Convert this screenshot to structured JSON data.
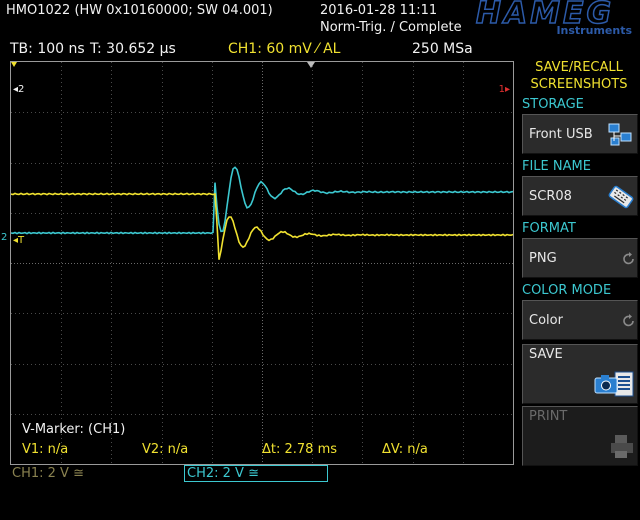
{
  "header": {
    "model": "HMO1022 (HW 0x10160000; SW 04.001)",
    "datetime": "2016-01-28 11:11",
    "status": "Norm-Trig. / Complete",
    "brand": "HAMEG",
    "brand_sub": "Instruments"
  },
  "acq": {
    "timebase": "TB: 100 ns",
    "trigger_time": "T: 30.652 µs",
    "ch1_trigger": "CH1: 60 mV ⁄ AL",
    "sample_rate": "250 MSa"
  },
  "markers": {
    "ch2_level": "2",
    "ch1_level": "1",
    "trigger_left": "T",
    "ch2_ground": "2"
  },
  "vmarker": {
    "title": "V-Marker: (CH1)",
    "v1": "V1: n/a",
    "v2": "V2: n/a",
    "dt": "Δt: 2.78 ms",
    "dv": "ΔV: n/a"
  },
  "channels": {
    "ch1": "CH1: 2 V ≅",
    "ch2": "CH2: 2 V ≅"
  },
  "menu": {
    "title_line1": "SAVE/RECALL",
    "title_line2": "SCREENSHOTS",
    "storage_label": "STORAGE",
    "storage_value": "Front USB",
    "filename_label": "FILE NAME",
    "filename_value": "SCR08",
    "format_label": "FORMAT",
    "format_value": "PNG",
    "colormode_label": "COLOR MODE",
    "colormode_value": "Color",
    "save_label": "SAVE",
    "print_label": "PRINT"
  },
  "colors": {
    "ch1": "#f0e130",
    "ch2": "#3cc8d0",
    "grid": "#4a4a4a",
    "brand": "#2c5aa8"
  },
  "icons": [
    "usb-folder-icon",
    "keyboard-icon",
    "refresh-icon",
    "camera-icon",
    "printer-icon"
  ]
}
